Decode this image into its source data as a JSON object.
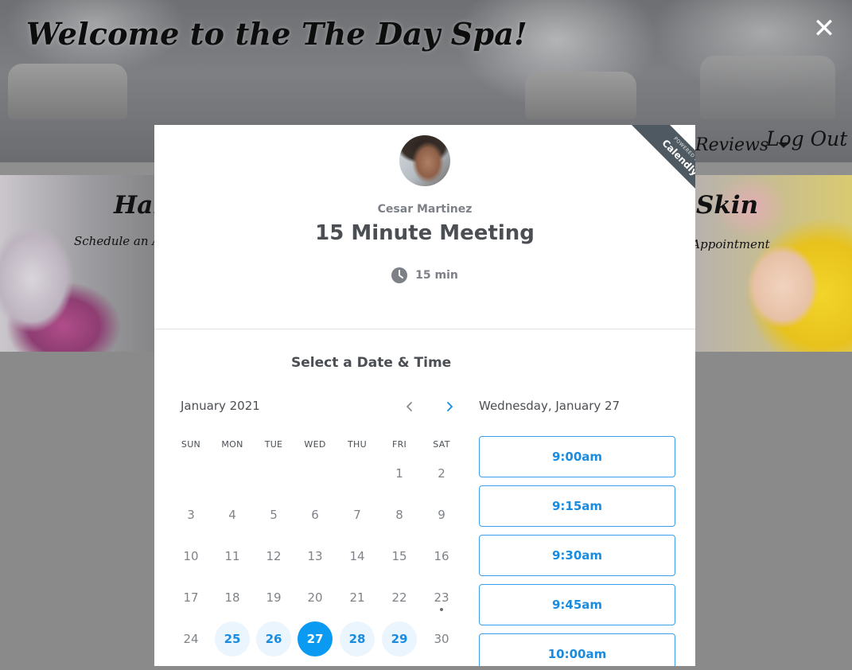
{
  "site": {
    "title": "Welcome to the The Day Spa!",
    "nav": {
      "reviews_label": "Reviews",
      "logout_label": "Log Out"
    },
    "close_glyph": "✕",
    "promos": [
      {
        "title": "Hair",
        "subtitle": "Schedule an Appointment"
      },
      {
        "title": "Skin",
        "subtitle": "Schedule an Appointment"
      }
    ]
  },
  "calendly": {
    "ribbon": {
      "powered_by": "POWERED BY",
      "brand": "Calendly"
    },
    "host_name": "Cesar Martinez",
    "event_title": "15 Minute Meeting",
    "duration": "15 min",
    "heading": "Select a Date & Time",
    "month_label": "January 2021",
    "weekdays": [
      "SUN",
      "MON",
      "TUE",
      "WED",
      "THU",
      "FRI",
      "SAT"
    ],
    "weeks": [
      [
        "",
        "",
        "",
        "",
        "",
        "1",
        "2"
      ],
      [
        "3",
        "4",
        "5",
        "6",
        "7",
        "8",
        "9"
      ],
      [
        "10",
        "11",
        "12",
        "13",
        "14",
        "15",
        "16"
      ],
      [
        "17",
        "18",
        "19",
        "20",
        "21",
        "22",
        "23"
      ],
      [
        "24",
        "25",
        "26",
        "27",
        "28",
        "29",
        "30"
      ]
    ],
    "available_days": [
      "25",
      "26",
      "27",
      "28",
      "29"
    ],
    "selected_day": "27",
    "today": "23",
    "selected_date_label": "Wednesday, January 27",
    "time_slots": [
      "9:00am",
      "9:15am",
      "9:30am",
      "9:45am",
      "10:00am"
    ],
    "accent_color": "#0a9af2"
  }
}
